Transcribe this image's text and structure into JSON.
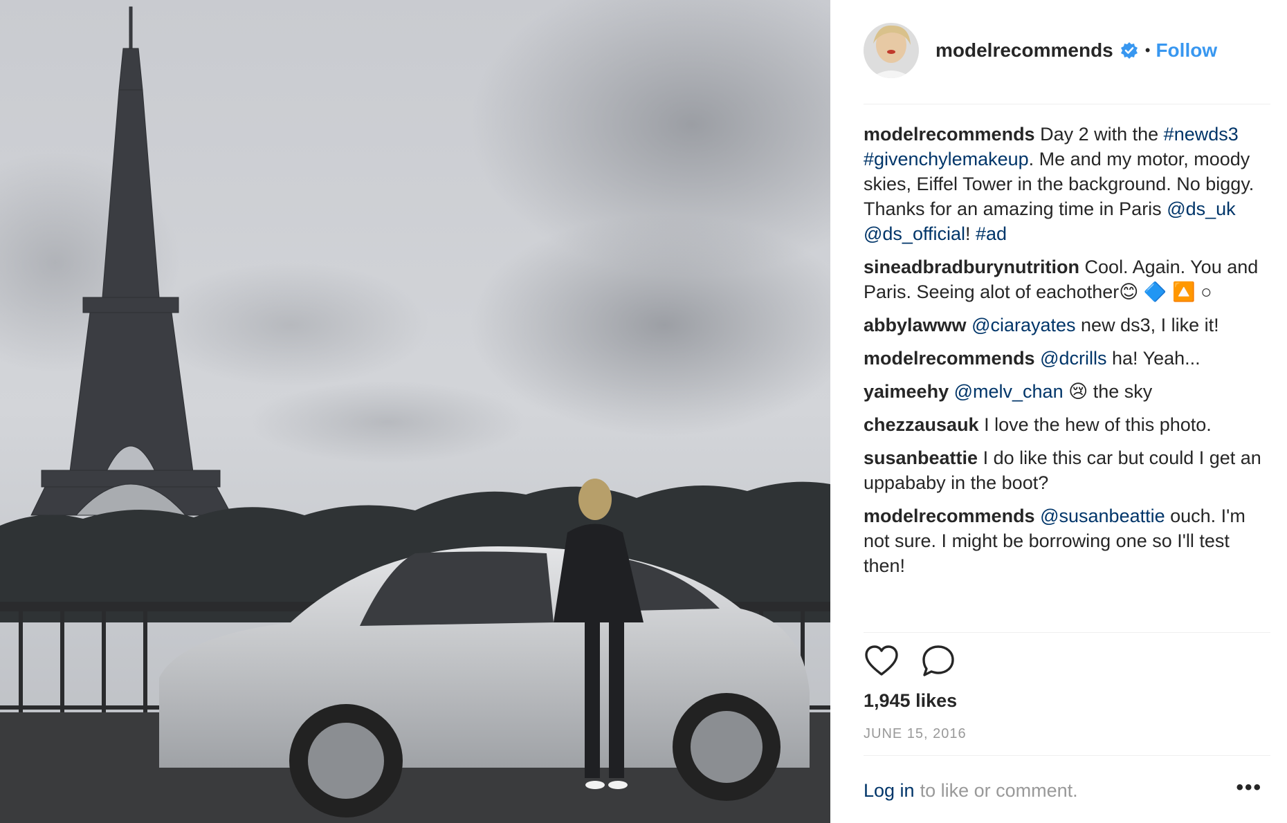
{
  "header": {
    "username": "modelrecommends",
    "separator": "•",
    "follow_label": "Follow"
  },
  "comments": [
    {
      "user": "modelrecommends",
      "parts": [
        {
          "text": " Day 2 with the "
        },
        {
          "text": "#newds3",
          "link": true
        },
        {
          "text": " "
        },
        {
          "text": "#givenchylemakeup",
          "link": true
        },
        {
          "text": ". Me and my motor, moody skies, Eiffel Tower in the background. No biggy. Thanks for an amazing time in Paris "
        },
        {
          "text": "@ds_uk",
          "link": true
        },
        {
          "text": " "
        },
        {
          "text": "@ds_official",
          "link": true
        },
        {
          "text": "! "
        },
        {
          "text": "#ad",
          "link": true
        }
      ]
    },
    {
      "user": "sineadbradburynutrition",
      "parts": [
        {
          "text": " Cool. Again. You and Paris. Seeing alot of eachother😊 🔷 🔼 ○"
        }
      ]
    },
    {
      "user": "abbylawww",
      "parts": [
        {
          "text": " "
        },
        {
          "text": "@ciarayates",
          "link": true
        },
        {
          "text": " new ds3, I like it!"
        }
      ]
    },
    {
      "user": "modelrecommends",
      "parts": [
        {
          "text": " "
        },
        {
          "text": "@dcrills",
          "link": true
        },
        {
          "text": " ha! Yeah..."
        }
      ]
    },
    {
      "user": "yaimeehy",
      "parts": [
        {
          "text": " "
        },
        {
          "text": "@melv_chan",
          "link": true
        },
        {
          "text": " 😢 the sky"
        }
      ]
    },
    {
      "user": "chezzausauk",
      "parts": [
        {
          "text": " I love the hew of this photo."
        }
      ]
    },
    {
      "user": "susanbeattie",
      "parts": [
        {
          "text": " I do like this car but could I get an uppababy in the boot?"
        }
      ]
    },
    {
      "user": "modelrecommends",
      "parts": [
        {
          "text": " "
        },
        {
          "text": "@susanbeattie",
          "link": true
        },
        {
          "text": " ouch. I'm not sure. I might be borrowing one so I'll test then!"
        }
      ]
    }
  ],
  "actions": {
    "like_icon": "heart-icon",
    "comment_icon": "comment-bubble-icon"
  },
  "likes_text": "1,945 likes",
  "date_text": "JUNE 15, 2016",
  "login": {
    "link_text": "Log in",
    "rest_text": "to like or comment.",
    "more_label": "•••"
  },
  "colors": {
    "follow": "#3897f0",
    "link": "#003569",
    "muted": "#999999",
    "verified": "#3897f0"
  }
}
